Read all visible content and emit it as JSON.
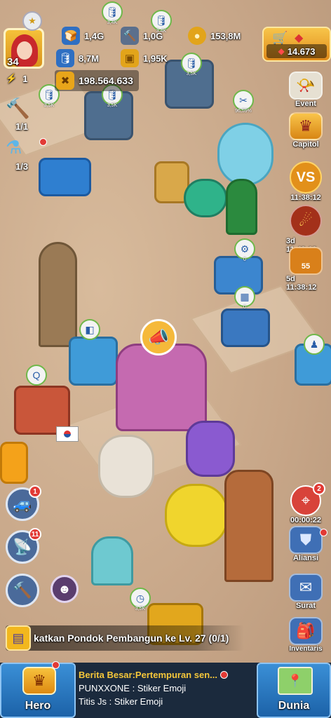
{
  "player": {
    "level": "34",
    "energy": "1",
    "power": "198.564.633"
  },
  "resources": [
    {
      "name": "food",
      "value": "1,4G",
      "icon": "🍞",
      "color": "#2f6fc2"
    },
    {
      "name": "iron",
      "value": "1,0G",
      "icon": "🔨",
      "color": "#5b6f8c"
    },
    {
      "name": "coin",
      "value": "153,8M",
      "icon": "●",
      "color": "#e2a41a"
    },
    {
      "name": "oil",
      "value": "8,7M",
      "icon": "🛢",
      "color": "#2f6fc2"
    },
    {
      "name": "ticket",
      "value": "1,95K",
      "icon": "▣",
      "color": "#e2a41a"
    }
  ],
  "shop": {
    "gems": "14.673"
  },
  "side_counters": {
    "builder": "1/1",
    "research": "1/3"
  },
  "map_labels": {
    "b1": "3,4K",
    "b2": "3,4K",
    "b3": "3,5K",
    "b4": "3,5K",
    "b5": "3,5K",
    "b6": "96,59%",
    "b7": "0",
    "b8": "0",
    "b9": "3,5K"
  },
  "right_menu": {
    "event": "Event",
    "capitol": "Capitol",
    "vs_timer": "11:38:12",
    "timer2": "3d 11:48:12",
    "timer3": "5d 11:38:12",
    "level_badge": "55"
  },
  "target_timer": "00:00:22",
  "target_badge": "2",
  "alliance": "Aliansi",
  "mail": "Surat",
  "inventory": "Inventaris",
  "left_buttons": {
    "car_badge": "1",
    "radar_badge": "11"
  },
  "quest": "katkan Pondok Pembangun ke Lv. 27 (0/1)",
  "bottom": {
    "hero": "Hero",
    "world": "Dunia",
    "news": "Berita Besar:Pertempuran sen...",
    "chat": [
      {
        "user": "PUNXXONE",
        "msg": "Stiker Emoji"
      },
      {
        "user": "Titis Js",
        "msg": "Stiker Emoji"
      }
    ]
  }
}
